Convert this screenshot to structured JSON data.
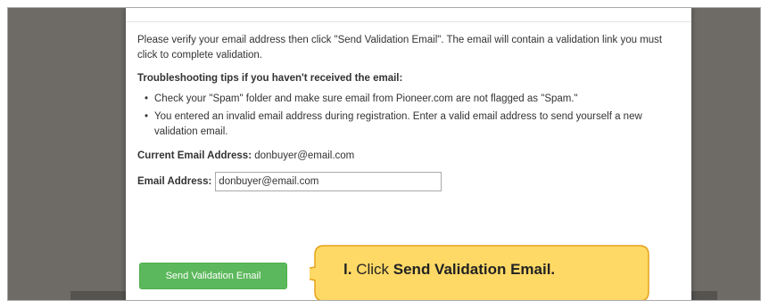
{
  "modal": {
    "intro": "Please verify your email address then click \"Send Validation Email\". The email will contain a validation link you must click to complete validation.",
    "tips_heading": "Troubleshooting tips if you haven't received the email:",
    "tips": [
      "Check your \"Spam\" folder and make sure email from Pioneer.com are not flagged as \"Spam.\"",
      "You entered an invalid email address during registration. Enter a valid email address to send yourself a new validation email."
    ],
    "current_email_label": "Current Email Address:",
    "current_email_value": "donbuyer@email.com",
    "email_field_label": "Email Address:",
    "email_field_value": "donbuyer@email.com",
    "send_button_label": "Send Validation Email"
  },
  "callout": {
    "step": "l.",
    "prefix": "Click",
    "action": "Send Validation  Email.",
    "fill_color": "#ffd966",
    "border_color": "#e3a21a"
  },
  "colors": {
    "button_green": "#5cb85c",
    "backdrop": "#6e6b66"
  }
}
